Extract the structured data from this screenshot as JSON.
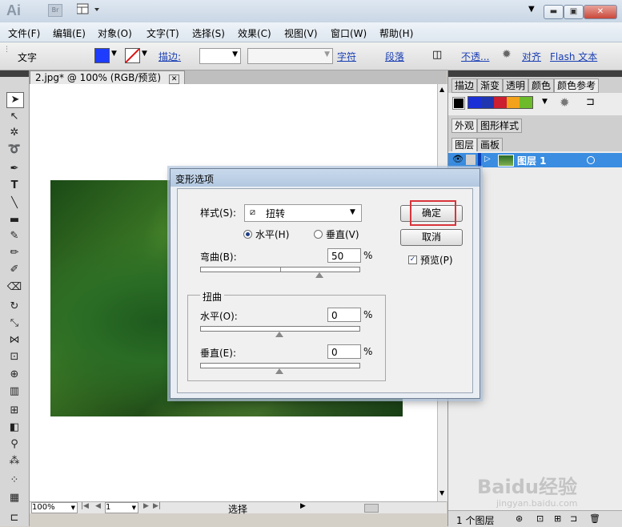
{
  "app": {
    "logo": "Ai",
    "bridge_badge": "Br"
  },
  "menu": [
    "文件(F)",
    "编辑(E)",
    "对象(O)",
    "文字(T)",
    "选择(S)",
    "效果(C)",
    "视图(V)",
    "窗口(W)",
    "帮助(H)"
  ],
  "control": {
    "mode": "文字",
    "stroke_label": "描边:",
    "char_link": "字符",
    "para_link": "段落",
    "opacity_link": "不透...",
    "align_link": "对齐",
    "flash_link": "Flash 文本",
    "fill_color": "#1e3cff"
  },
  "document": {
    "tab": "2.jpg* @ 100% (RGB/预览)"
  },
  "status": {
    "zoom": "100%",
    "page": "1",
    "tool": "选择"
  },
  "panels": {
    "tabs_top": [
      "描边",
      "渐变",
      "透明",
      "颜色",
      "颜色参考"
    ],
    "swatch_colors": [
      "#1b2fd6",
      "#2036b0",
      "#cc1f2f",
      "#f2a21b",
      "#6dbb2b"
    ],
    "tabs_mid": [
      "外观",
      "图形样式"
    ],
    "tabs_layers": [
      "图层",
      "画板"
    ],
    "layer_name": "图层 1",
    "layers_count": "1 个图层"
  },
  "dialog": {
    "title": "变形选项",
    "style_label": "样式(S):",
    "style_value": "扭转",
    "horizontal": "水平(H)",
    "vertical": "垂直(V)",
    "bend_label": "弯曲(B):",
    "bend_value": "50",
    "percent": "%",
    "distortion_group": "扭曲",
    "dist_h_label": "水平(O):",
    "dist_h_value": "0",
    "dist_v_label": "垂直(E):",
    "dist_v_value": "0",
    "ok": "确定",
    "cancel": "取消",
    "preview": "预览(P)",
    "bend_level": 0.75,
    "dist_h_level": 0.5,
    "dist_v_level": 0.5
  },
  "watermark": {
    "brand": "Baidu经验",
    "url": "jingyan.baidu.com"
  }
}
